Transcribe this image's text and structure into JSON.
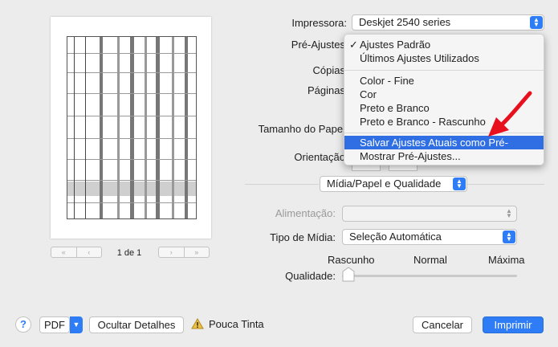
{
  "preview": {
    "page_counter": "1 de 1"
  },
  "printer": {
    "label": "Impressora:",
    "value": "Deskjet 2540 series"
  },
  "presets": {
    "label": "Pré-Ajustes",
    "menu": {
      "items": [
        "Ajustes Padrão",
        "Últimos Ajustes Utilizados",
        "Color - Fine",
        "Cor",
        "Preto e Branco",
        "Preto e Branco - Rascunho",
        "Salvar Ajustes Atuais como Pré-Ajuste...",
        "Mostrar Pré-Ajustes..."
      ],
      "checked_mark": "✓",
      "highlighted_index": 6
    }
  },
  "copies": {
    "label": "Cópias"
  },
  "pages": {
    "label": "Páginas"
  },
  "paper_size": {
    "label": "Tamanho do Papel"
  },
  "orientation": {
    "label": "Orientação"
  },
  "section": {
    "value": "Mídia/Papel e Qualidade"
  },
  "feed": {
    "label": "Alimentação:",
    "value": ""
  },
  "media_type": {
    "label": "Tipo de Mídia:",
    "value": "Seleção Automática"
  },
  "quality": {
    "label": "Qualidade:",
    "ticks": [
      "Rascunho",
      "Normal",
      "Máxima"
    ],
    "level": 0
  },
  "footer": {
    "help": "?",
    "pdf": "PDF",
    "hide_details": "Ocultar Detalhes",
    "low_ink": "Pouca Tinta",
    "cancel": "Cancelar",
    "print": "Imprimir"
  },
  "colors": {
    "accent": "#2f7df6",
    "highlight": "#2f6fe3",
    "arrow": "#e8101e"
  },
  "icons": {
    "warning": "warning-icon"
  }
}
